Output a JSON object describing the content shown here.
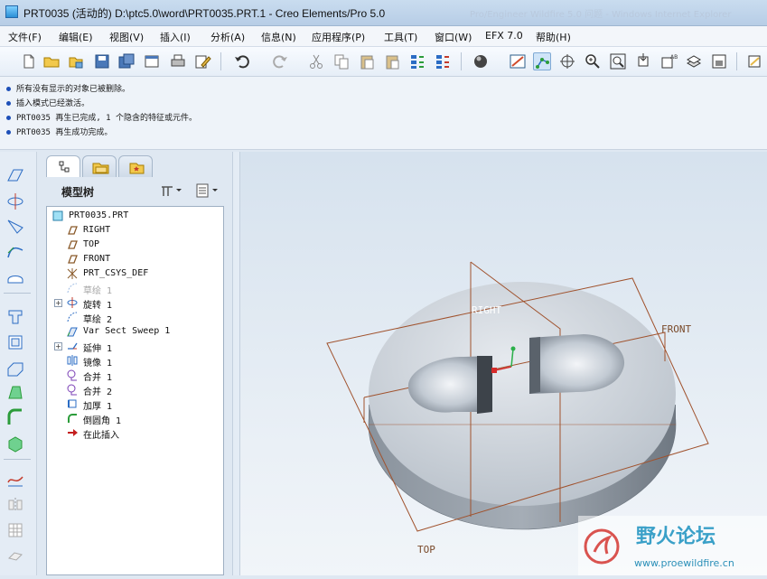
{
  "window": {
    "title": "PRT0035 (活动的) D:\\ptc5.0\\word\\PRT0035.PRT.1 - Creo Elements/Pro 5.0",
    "background_title": "Pro/Engineer Wildfire 5.0 问题 - Windows Internet Explorer"
  },
  "menu": [
    "文件(F)",
    "编辑(E)",
    "视图(V)",
    "插入(I)",
    "分析(A)",
    "信息(N)",
    "应用程序(P)",
    "工具(T)",
    "窗口(W)",
    "EFX 7.0",
    "帮助(H)"
  ],
  "messages": [
    "所有没有显示的对象已被删除。",
    "插入模式已经激活。",
    "PRT0035 再生已完成, 1 个隐含的特征或元件。",
    "PRT0035 再生成功完成。"
  ],
  "panel": {
    "title": "模型树",
    "tabs": [
      "model-tree-tab",
      "layer-tab",
      "favorites-tab"
    ]
  },
  "tree": {
    "root": "PRT0035.PRT",
    "items": [
      {
        "label": "RIGHT",
        "icon": "datum-plane-icon"
      },
      {
        "label": "TOP",
        "icon": "datum-plane-icon"
      },
      {
        "label": "FRONT",
        "icon": "datum-plane-icon"
      },
      {
        "label": "PRT_CSYS_DEF",
        "icon": "csys-icon"
      },
      {
        "label": "草绘 1",
        "icon": "sketch-icon",
        "dim": true
      },
      {
        "label": "旋转 1",
        "icon": "revolve-icon",
        "expandable": true
      },
      {
        "label": "草绘 2",
        "icon": "sketch-icon"
      },
      {
        "label": "Var Sect Sweep 1",
        "icon": "sweep-icon"
      },
      {
        "label": "延伸 1",
        "icon": "extend-icon",
        "expandable": true
      },
      {
        "label": "镜像 1",
        "icon": "mirror-icon"
      },
      {
        "label": "合并 1",
        "icon": "merge-icon"
      },
      {
        "label": "合并 2",
        "icon": "merge-icon"
      },
      {
        "label": "加厚 1",
        "icon": "thicken-icon"
      },
      {
        "label": "倒圆角 1",
        "icon": "round-icon"
      },
      {
        "label": "在此插入",
        "icon": "insert-here-icon"
      }
    ]
  },
  "viewport": {
    "datum_labels": {
      "right": "RIGHT",
      "front": "FRONT",
      "top": "TOP"
    },
    "plane_color": "#a0522d",
    "model_color": "#c5ccd4"
  },
  "watermark": {
    "title": "野火论坛",
    "url": "www.proewildfire.cn"
  }
}
